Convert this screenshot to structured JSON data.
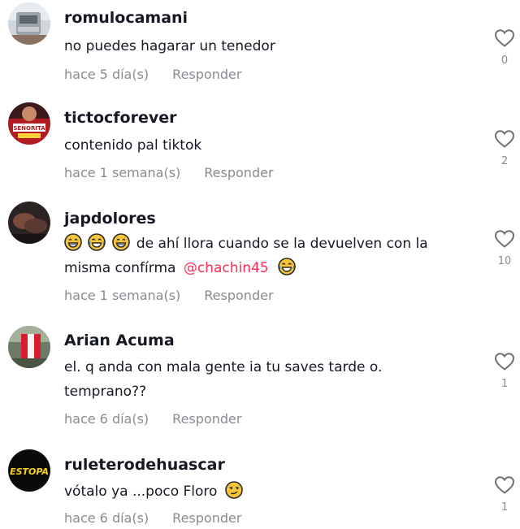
{
  "comments": [
    {
      "username": "romulocamani",
      "text": "no puedes hagarar un tenedor",
      "time": "hace 5 día(s)",
      "reply": "Responder",
      "likes": "0",
      "avatar": "truck-avatar"
    },
    {
      "username": "tictocforever",
      "text": "contenido pal tiktok",
      "time": "hace 1 semana(s)",
      "reply": "Responder",
      "likes": "2",
      "avatar": "senorita-avatar"
    },
    {
      "username": "japdolores",
      "text_line1": "de ahí llora cuando se la devuelven con la",
      "text_line2": "misma confírma",
      "mention": "@chachin45",
      "time": "hace 1 semana(s)",
      "reply": "Responder",
      "likes": "10",
      "avatar": "photo-avatar"
    },
    {
      "username": "Arian Acuma",
      "text_line1": "el. q anda con mala gente ia tu saves tarde o.",
      "text_line2": "temprano??",
      "time": "hace 6 día(s)",
      "reply": "Responder",
      "likes": "1",
      "avatar": "flag-avatar"
    },
    {
      "username": "ruleterodehuascar",
      "text": "vótalo ya ...poco Floro",
      "time": "hace 6 día(s)",
      "reply": "Responder",
      "likes": "1",
      "avatar": "estopa-avatar"
    }
  ],
  "estopa_logo_text": "ESTOPA",
  "senorita_logo_text": "SEÑORITA",
  "colors": {
    "text": "#161823",
    "secondary": "#8a8b91",
    "mention": "#fe2c55"
  }
}
